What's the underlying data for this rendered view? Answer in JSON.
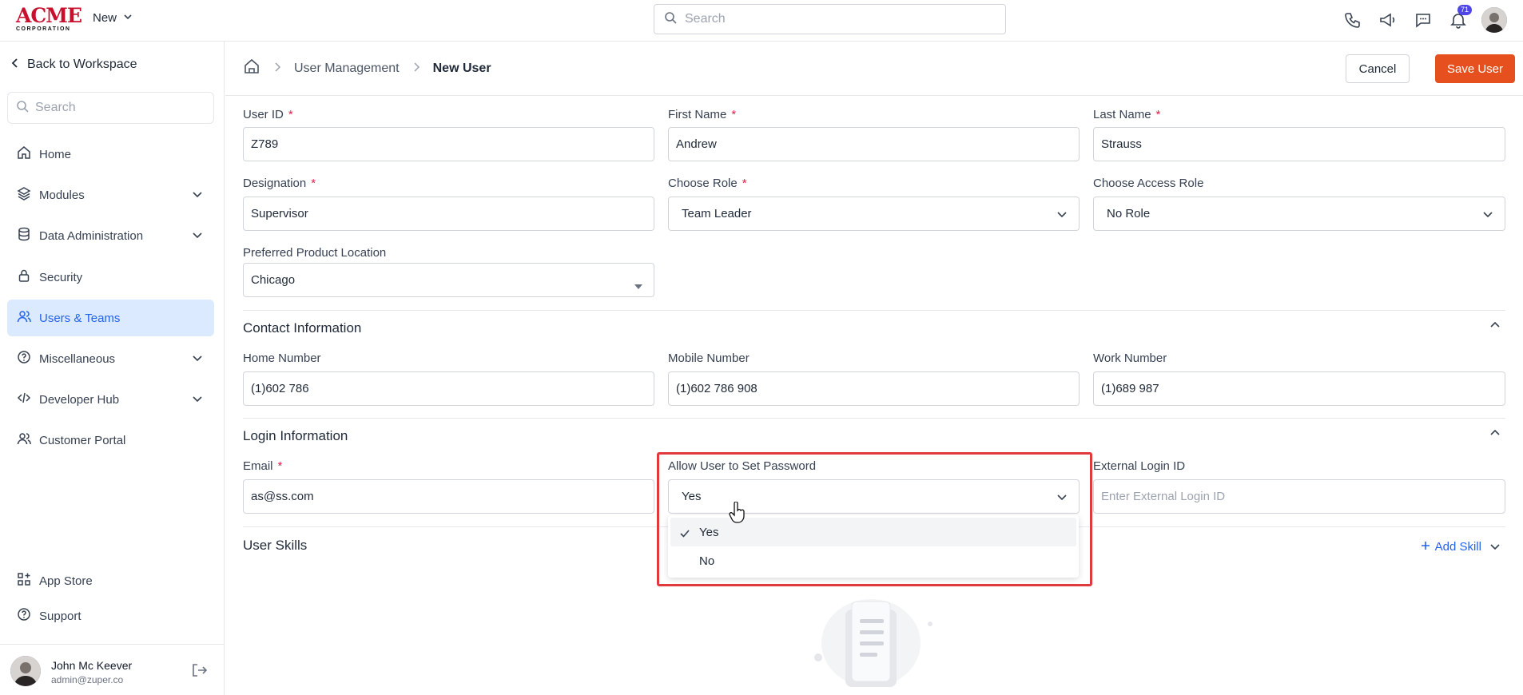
{
  "topbar": {
    "logo_main": "ACME",
    "logo_sub": "CORPORATION",
    "new_label": "New",
    "search_placeholder": "Search",
    "notification_count": "71"
  },
  "sidebar": {
    "back_label": "Back to Workspace",
    "search_placeholder": "Search",
    "items": [
      {
        "label": "Home",
        "icon": "home-icon",
        "expandable": false
      },
      {
        "label": "Modules",
        "icon": "layers-icon",
        "expandable": true
      },
      {
        "label": "Data Administration",
        "icon": "database-icon",
        "expandable": true
      },
      {
        "label": "Security",
        "icon": "lock-icon",
        "expandable": false
      },
      {
        "label": "Users & Teams",
        "icon": "users-icon",
        "expandable": false,
        "active": true
      },
      {
        "label": "Miscellaneous",
        "icon": "help-circle-icon",
        "expandable": true
      },
      {
        "label": "Developer Hub",
        "icon": "code-icon",
        "expandable": true
      },
      {
        "label": "Customer Portal",
        "icon": "user-icon",
        "expandable": false
      }
    ],
    "bottom_items": [
      {
        "label": "App Store",
        "icon": "apps-icon"
      },
      {
        "label": "Support",
        "icon": "help-icon"
      }
    ],
    "user": {
      "name": "John Mc Keever",
      "email": "admin@zuper.co"
    }
  },
  "header": {
    "breadcrumb": [
      "User Management",
      "New User"
    ],
    "cancel_label": "Cancel",
    "save_label": "Save User"
  },
  "form": {
    "user_id": {
      "label": "User ID",
      "value": "Z789"
    },
    "first_name": {
      "label": "First Name",
      "value": "Andrew"
    },
    "last_name": {
      "label": "Last Name",
      "value": "Strauss"
    },
    "designation": {
      "label": "Designation",
      "value": "Supervisor"
    },
    "role": {
      "label": "Choose Role",
      "value": "Team Leader"
    },
    "access_role": {
      "label": "Choose Access Role",
      "value": "No Role"
    },
    "product_location": {
      "label": "Preferred Product Location",
      "value": "Chicago"
    }
  },
  "contact": {
    "title": "Contact Information",
    "home": {
      "label": "Home Number",
      "value": "(1)602 786"
    },
    "mobile": {
      "label": "Mobile Number",
      "value": "(1)602 786 908"
    },
    "work": {
      "label": "Work Number",
      "value": "(1)689 987"
    }
  },
  "login": {
    "title": "Login Information",
    "email": {
      "label": "Email",
      "value": "as@ss.com"
    },
    "allow_password": {
      "label": "Allow User to Set Password",
      "value": "Yes",
      "options": [
        "Yes",
        "No"
      ]
    },
    "external_id": {
      "label": "External Login ID",
      "placeholder": "Enter External Login ID"
    }
  },
  "skills": {
    "title": "User Skills",
    "add_label": "Add Skill"
  },
  "colors": {
    "accent": "#e5501e",
    "active_nav": "#dbeafe",
    "link": "#2563eb",
    "highlight": "#e03a3e"
  }
}
